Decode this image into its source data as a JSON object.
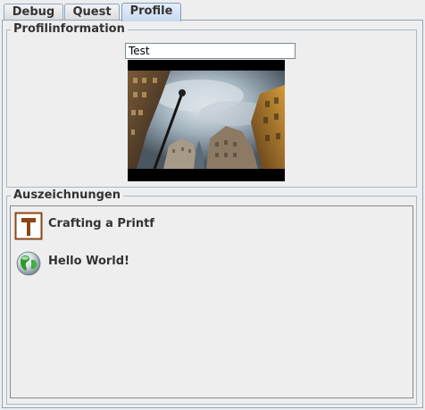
{
  "tabs": [
    {
      "label": "Debug"
    },
    {
      "label": "Quest"
    },
    {
      "label": "Profile"
    }
  ],
  "profile": {
    "group_title": "Profilinformation",
    "name_value": "Test"
  },
  "awards": {
    "group_title": "Auszeichnungen",
    "items": [
      {
        "label": "Crafting a Printf",
        "icon": "hammer-icon"
      },
      {
        "label": "Hello World!",
        "icon": "globe-icon"
      }
    ]
  },
  "colors": {
    "tab_active": "#c8daf0",
    "border": "#8ea6c2",
    "hammer": "#8b4513"
  }
}
